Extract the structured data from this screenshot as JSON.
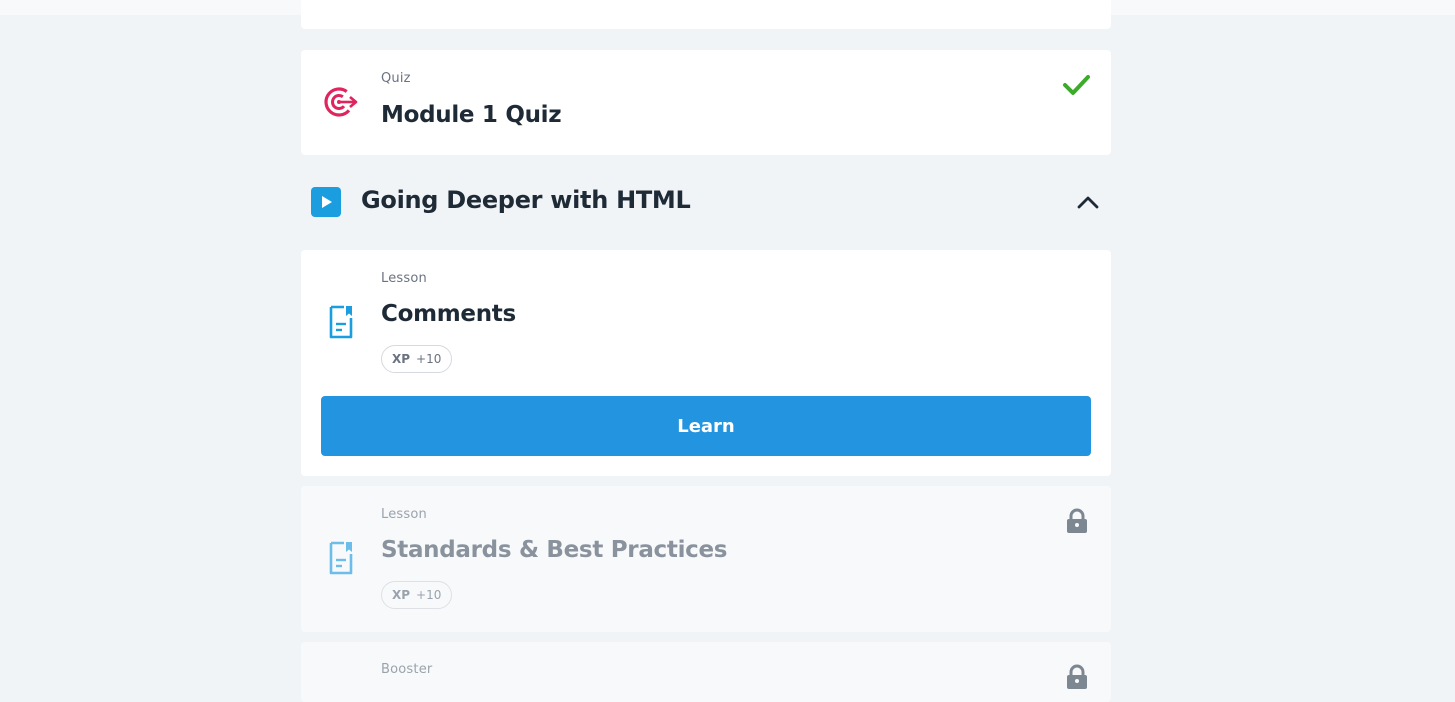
{
  "quiz_card": {
    "kind": "Quiz",
    "title": "Module 1 Quiz",
    "icon": "target-icon",
    "status": "completed",
    "accent": "#e0245e",
    "check_color": "#3cab29"
  },
  "section": {
    "title": "Going Deeper with HTML",
    "icon": "play-icon",
    "accent": "#1b9ee0",
    "expanded": true
  },
  "lessons": [
    {
      "kind": "Lesson",
      "title": "Comments",
      "xp_label": "XP",
      "xp_value": "+10",
      "button_label": "Learn",
      "locked": false,
      "icon": "document-icon"
    },
    {
      "kind": "Lesson",
      "title": "Standards & Best Practices",
      "xp_label": "XP",
      "xp_value": "+10",
      "locked": true,
      "icon": "document-icon"
    },
    {
      "kind": "Booster",
      "locked": true
    }
  ],
  "colors": {
    "page_bg": "#f0f4f7",
    "card_bg": "#ffffff",
    "button_bg": "#2394df",
    "lesson_icon": "#1b9ee0",
    "locked_icon": "#7d8792"
  }
}
